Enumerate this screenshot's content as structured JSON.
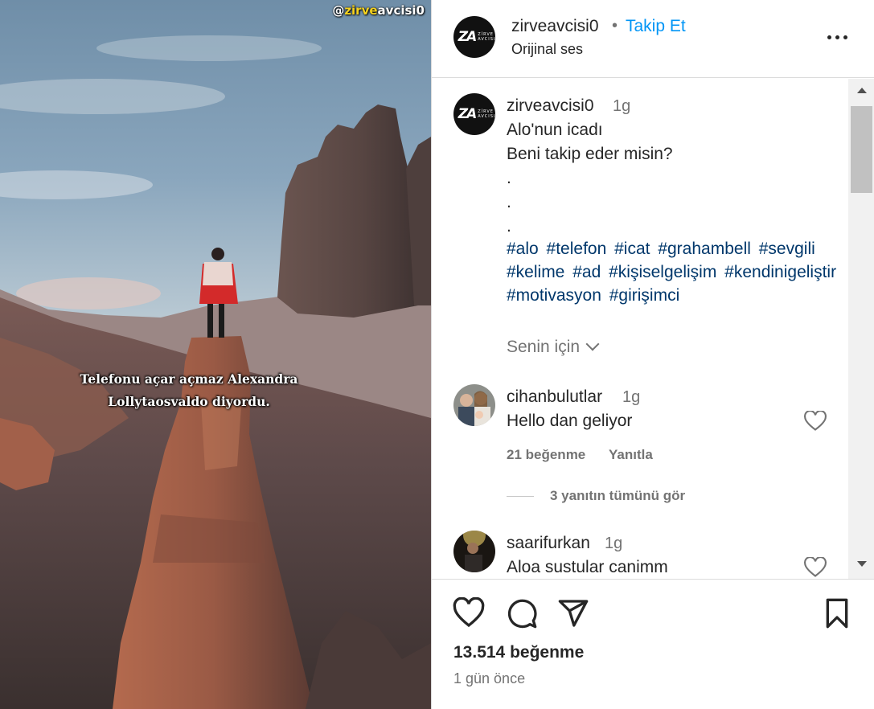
{
  "media": {
    "watermark_prefix": "@",
    "watermark_accent": "zirve",
    "watermark_suffix": "avcisi0",
    "subtitle": "Telefonu açar açmaz Alexandra Lollytaosvaldo diyordu."
  },
  "header": {
    "avatar_logo": "ZA",
    "avatar_logo_small": "ZİRVE AVCISI",
    "username": "zirveavcisi0",
    "separator": "•",
    "follow_label": "Takip Et",
    "audio_label": "Orijinal ses"
  },
  "caption": {
    "username": "zirveavcisi0",
    "time": "1g",
    "text": "Alo'nun icadı\nBeni takip eder misin?\n.\n.\n.",
    "hashtags": [
      "#alo",
      "#telefon",
      "#icat",
      "#grahambell",
      "#sevgili",
      "#kelime",
      "#ad",
      "#kişiselgelişim",
      "#kendinigeliştir",
      "#motivasyon",
      "#girişimci"
    ],
    "for_you_label": "Senin için"
  },
  "comments": [
    {
      "username": "cihanbulutlar",
      "time": "1g",
      "text": "Hello dan geliyor",
      "likes_label": "21 beğenme",
      "reply_label": "Yanıtla",
      "view_replies_label": "3 yanıtın tümünü gör"
    },
    {
      "username": "saarifurkan",
      "time": "1g",
      "text": "Aloa sustular canimm"
    }
  ],
  "footer": {
    "likes_count": "13.514 beğenme",
    "date": "1 gün önce"
  },
  "colors": {
    "link_blue": "#0095f6",
    "hashtag": "#00376b",
    "muted": "#737373",
    "text": "#262626",
    "watermark_accent": "#f5d21e"
  },
  "icons": [
    "more-icon",
    "chevron-down-icon",
    "heart-icon",
    "comment-icon",
    "share-icon",
    "bookmark-icon"
  ]
}
